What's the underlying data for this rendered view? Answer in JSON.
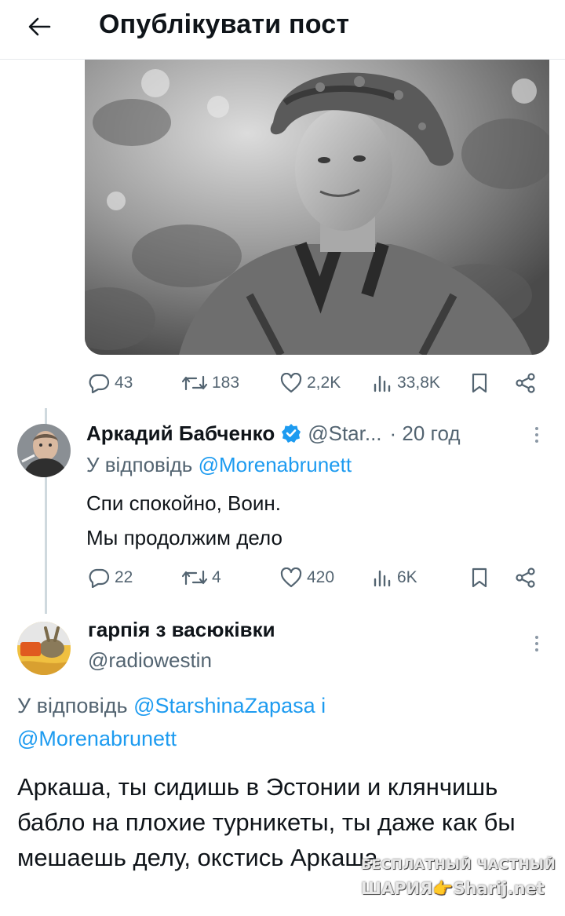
{
  "header": {
    "title": "Опублікувати пост"
  },
  "post": {
    "stats": {
      "replies": "43",
      "reposts": "183",
      "likes": "2,2K",
      "views": "33,8K"
    }
  },
  "reply1": {
    "author_name": "Аркадий Бабченко",
    "handle": "@Star...",
    "time": "· 20 год",
    "reply_to_prefix": "У відповідь",
    "reply_to_mention": "@Morenabrunett",
    "text_line1": "Спи спокойно, Воин.",
    "text_line2": "Мы продолжим дело",
    "stats": {
      "replies": "22",
      "reposts": "4",
      "likes": "420",
      "views": "6K"
    }
  },
  "reply2": {
    "author_name": "гарпія з васюківки",
    "handle": "@radiowestin",
    "reply_to_prefix": "У відповідь",
    "reply_to_mention1": "@StarshinaZapasa",
    "reply_to_and": "і",
    "reply_to_mention2": "@Morenabrunett",
    "text": "Аркаша, ты сидишь в Эстонии и клянчишь бабло на плохие турникеты, ты даже как бы мешаешь делу, окстись Аркаша"
  },
  "watermark": {
    "line1": "БЕСПЛАТНЫЙ ЧАСТНЫЙ",
    "line2": "ШАРИЯ👉Sharij.net"
  },
  "colors": {
    "accent": "#1d9bf0",
    "secondary_text": "#536471",
    "primary_text": "#0f1419"
  }
}
